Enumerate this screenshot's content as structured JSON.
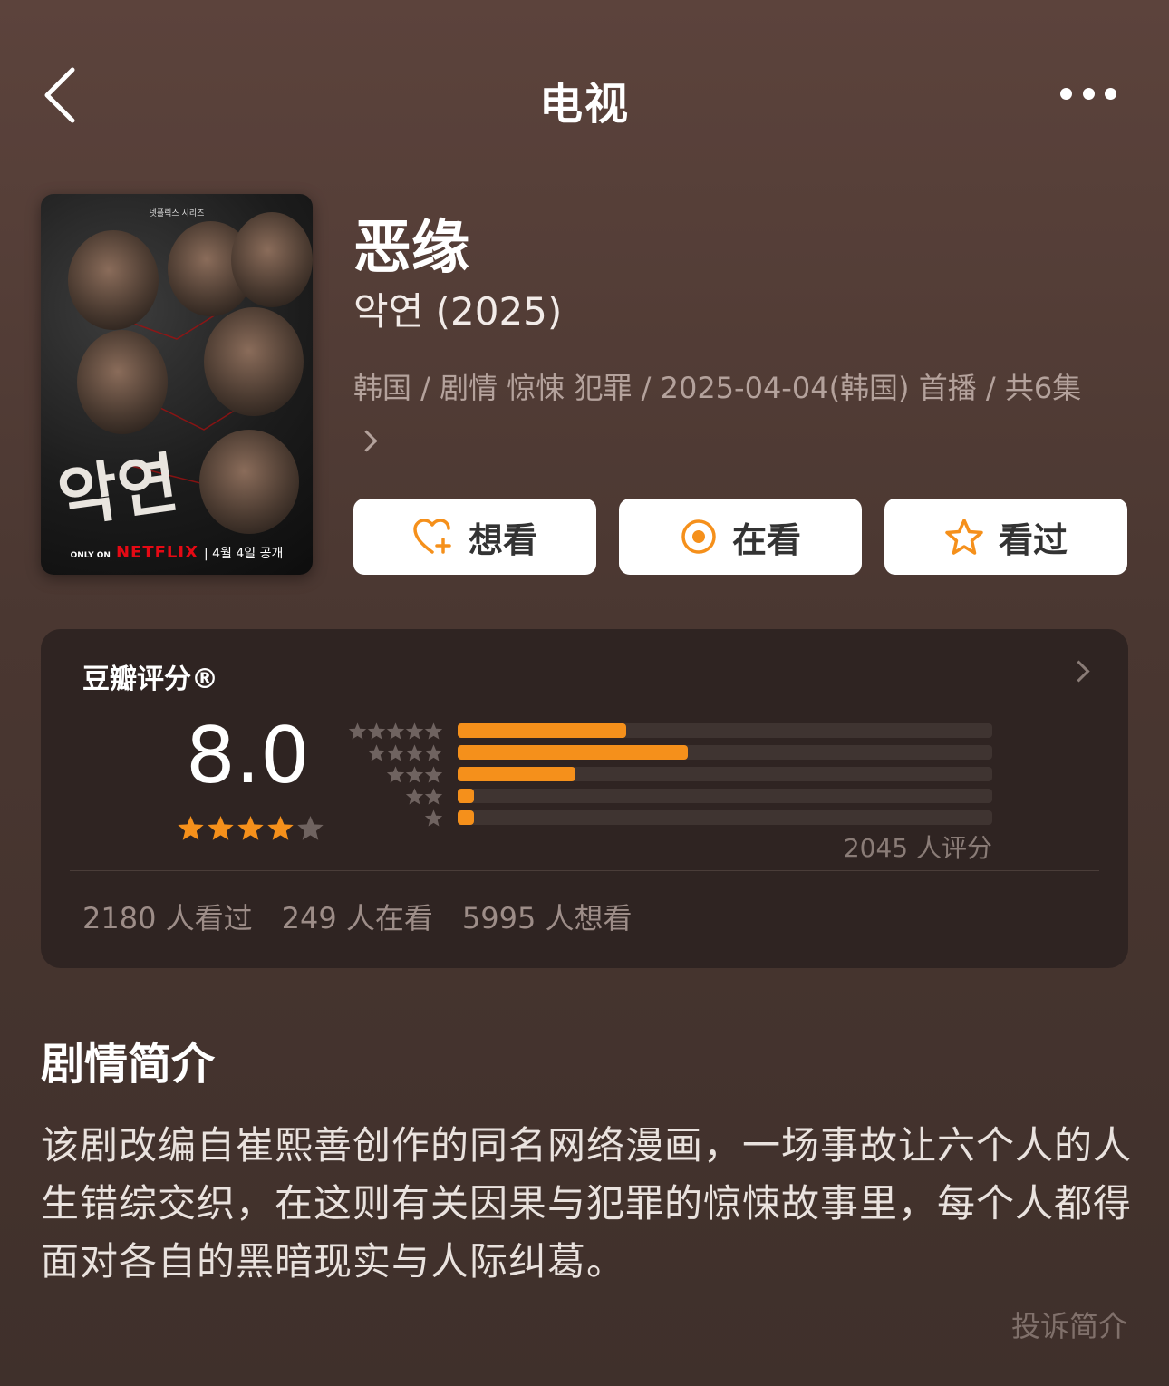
{
  "nav": {
    "title": "电视",
    "back_icon": "chevron-left-icon",
    "more_icon": "more-dots-icon"
  },
  "poster": {
    "top_text": "넷플릭스 시리즈",
    "korean_title": "악연",
    "only_on": "ONLY ON",
    "netflix": "NETFLIX",
    "release": "4월 4일 공개"
  },
  "title": "恶缘",
  "subtitle": "악연 (2025)",
  "meta": "韩国 / 剧情 惊悚 犯罪 / 2025-04-04(韩国) 首播 / 共6集",
  "actions": [
    {
      "label": "想看",
      "icon": "heart-plus-icon"
    },
    {
      "label": "在看",
      "icon": "target-icon"
    },
    {
      "label": "看过",
      "icon": "star-outline-icon"
    }
  ],
  "rating": {
    "label": "豆瓣评分®",
    "score": "8.0",
    "stars_filled": 4,
    "count_text": "2045 人评分",
    "distribution": [
      {
        "stars": 5,
        "fraction": 0.315
      },
      {
        "stars": 4,
        "fraction": 0.43
      },
      {
        "stars": 3,
        "fraction": 0.22
      },
      {
        "stars": 2,
        "fraction": 0.03
      },
      {
        "stars": 1,
        "fraction": 0.03
      }
    ],
    "stats": [
      "2180 人看过",
      "249 人在看",
      "5995 人想看"
    ],
    "accent": "#f5901b"
  },
  "synopsis": {
    "title": "剧情简介",
    "text": "该剧改编自崔熙善创作的同名网络漫画，一场事故让六个人的人生错综交织，在这则有关因果与犯罪的惊悚故事里，每个人都得面对各自的黑暗现实与人际纠葛。",
    "report": "投诉简介"
  }
}
